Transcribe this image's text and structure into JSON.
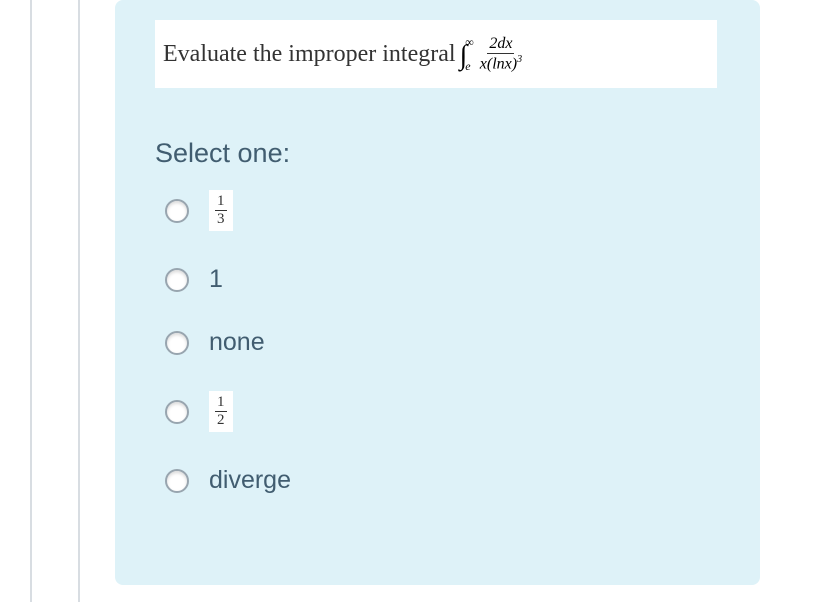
{
  "question": {
    "prefix": "Evaluate the improper integral ",
    "upper_limit": "∞",
    "lower_limit": "e",
    "numerator": "2dx",
    "denominator_x": "x",
    "denominator_ln": "(lnx)",
    "denominator_exp": "3"
  },
  "prompt": "Select one:",
  "options": {
    "a": {
      "type": "fraction",
      "num": "1",
      "den": "3"
    },
    "b": {
      "type": "text",
      "label": "1"
    },
    "c": {
      "type": "text",
      "label": "none"
    },
    "d": {
      "type": "fraction",
      "num": "1",
      "den": "2"
    },
    "e": {
      "type": "text",
      "label": "diverge"
    }
  }
}
